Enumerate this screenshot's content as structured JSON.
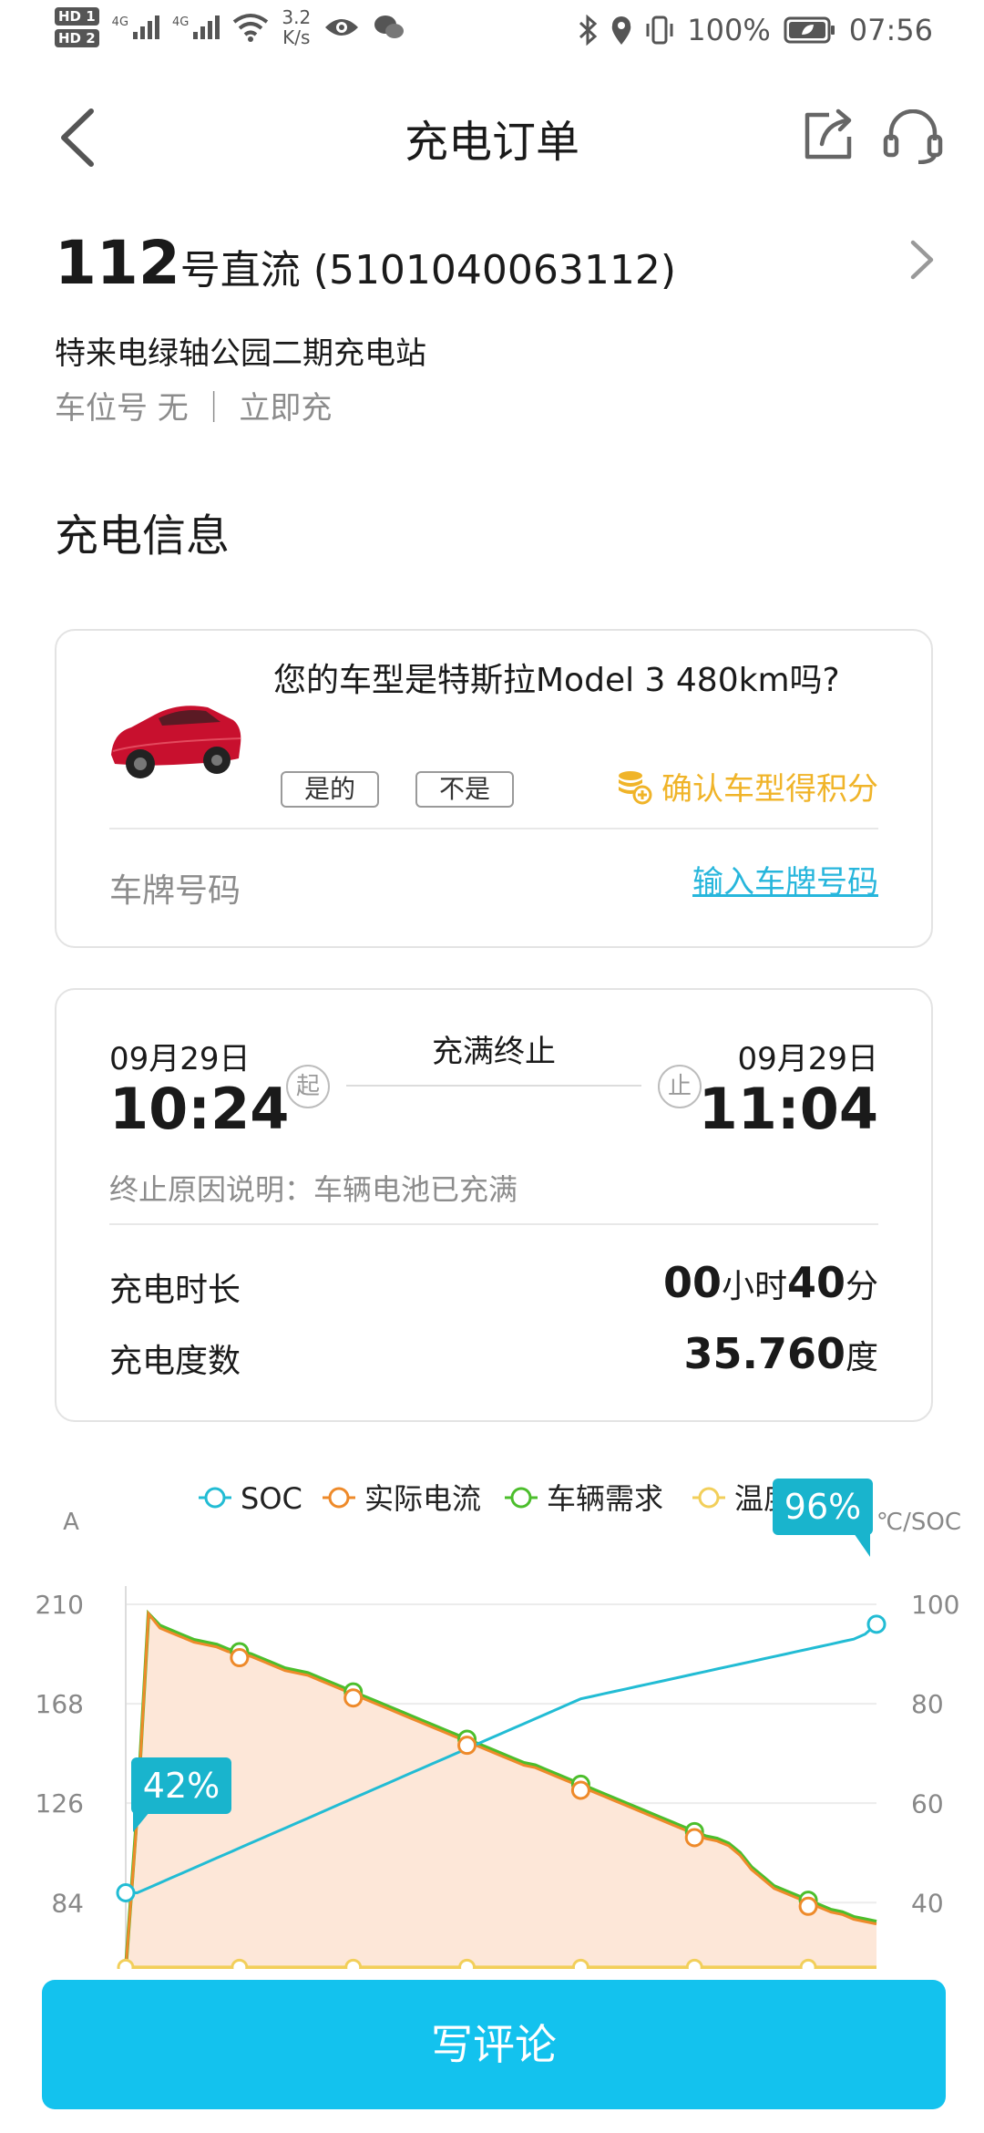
{
  "status_bar": {
    "hd1": "HD 1",
    "hd2": "HD 2",
    "net1": "4G",
    "net2": "4G",
    "speed_value": "3.2",
    "speed_unit": "K/s",
    "battery": "100%",
    "time": "07:56"
  },
  "nav": {
    "title": "充电订单",
    "icons": [
      "back-arrow-icon",
      "share-icon",
      "headset-icon"
    ]
  },
  "station": {
    "number": "112",
    "type": "号直流",
    "code": "(5101040063112)",
    "name": "特来电绿轴公园二期充电站",
    "meta": "车位号 无 ｜ 立即充"
  },
  "section_title": "充电信息",
  "car_card": {
    "question": "您的车型是特斯拉Model 3 480km吗?",
    "yes_label": "是的",
    "no_label": "不是",
    "points_label": "确认车型得积分",
    "plate_label": "车牌号码",
    "plate_link": "输入车牌号码",
    "car_color": "#c8102e"
  },
  "time_card": {
    "start_date": "09月29日",
    "start_time": "10:24",
    "end_date": "09月29日",
    "end_time": "11:04",
    "status": "充满终止",
    "start_marker": "起",
    "end_marker": "止",
    "reason": "终止原因说明：车辆电池已充满",
    "duration_label": "充电时长",
    "duration_hours": "00",
    "duration_hours_unit": "小时",
    "duration_minutes": "40",
    "duration_minutes_unit": "分",
    "energy_label": "充电度数",
    "energy_value": "35.760",
    "energy_unit": "度"
  },
  "chart_data": {
    "type": "line",
    "legend": [
      "SOC",
      "实际电流",
      "车辆需求",
      "温度"
    ],
    "left_axis_label": "A",
    "right_axis_label": "℃/SOC",
    "left_ticks": [
      210,
      168,
      126,
      84
    ],
    "right_ticks": [
      100,
      80,
      60,
      40
    ],
    "left_ylim": [
      56,
      210
    ],
    "right_ylim": [
      26.7,
      100
    ],
    "x": [
      0,
      1,
      2,
      3,
      4,
      5,
      6,
      7,
      8,
      9,
      10,
      11,
      12,
      13,
      14,
      15,
      16,
      17,
      18,
      19,
      20,
      21,
      22,
      23,
      24,
      25,
      26,
      27,
      28,
      29,
      30,
      31,
      32,
      33,
      34,
      35,
      36,
      37,
      38,
      39,
      40,
      41,
      42,
      43,
      44,
      45,
      46,
      47,
      48,
      49,
      50,
      51,
      52,
      53,
      54,
      55,
      56,
      57,
      58,
      59,
      60,
      61,
      62,
      63,
      64,
      65,
      66
    ],
    "series": [
      {
        "name": "SOC",
        "color": "#22bcd4",
        "values": [
          42,
          42,
          43,
          44,
          45,
          46,
          47,
          48,
          49,
          50,
          51,
          52,
          53,
          54,
          55,
          56,
          57,
          58,
          59,
          60,
          61,
          62,
          63,
          64,
          65,
          66,
          67,
          68,
          69,
          70,
          71,
          72,
          73,
          74,
          75,
          76,
          77,
          78,
          79,
          80,
          81,
          81.5,
          82,
          82.5,
          83,
          83.5,
          84,
          84.5,
          85,
          85.5,
          86,
          86.5,
          87,
          87.5,
          88,
          88.5,
          89,
          89.5,
          90,
          90.5,
          91,
          91.5,
          92,
          92.5,
          93,
          94,
          96
        ]
      },
      {
        "name": "实际电流",
        "color": "#ee8a2a",
        "values": [
          56,
          120,
          206,
          200,
          198,
          196,
          194,
          193,
          192,
          190,
          189,
          188,
          186,
          184,
          182,
          181,
          180,
          178,
          176,
          174,
          172,
          170,
          168,
          166,
          164,
          162,
          160,
          158,
          156,
          154,
          152,
          150,
          148,
          146,
          144,
          142,
          141,
          139,
          137,
          135,
          133,
          131,
          129,
          127,
          125,
          123,
          121,
          119,
          117,
          115,
          113,
          111,
          110,
          108,
          104,
          98,
          94,
          90,
          88,
          86,
          84,
          82,
          80,
          79,
          77,
          76,
          75
        ]
      },
      {
        "name": "车辆需求",
        "color": "#4cbe2c",
        "values": [
          56,
          122,
          206,
          201,
          199,
          197,
          195,
          194,
          193,
          191,
          190,
          189,
          187,
          185,
          183,
          182,
          181,
          179,
          177,
          175,
          173,
          171,
          169,
          167,
          165,
          163,
          161,
          159,
          157,
          155,
          153,
          151,
          149,
          147,
          145,
          143,
          142,
          140,
          138,
          136,
          134,
          132,
          130,
          128,
          126,
          124,
          122,
          120,
          118,
          116,
          114,
          112,
          111,
          109,
          105,
          99,
          95,
          91,
          89,
          87,
          85,
          83,
          81,
          80,
          78,
          77,
          76
        ]
      },
      {
        "name": "温度",
        "color": "#f2cf5a",
        "values": [
          27,
          27,
          27,
          27,
          27,
          27,
          27,
          27,
          27,
          27,
          27,
          27,
          27,
          27,
          27,
          27,
          27,
          27,
          27,
          27,
          27,
          27,
          27,
          27,
          27,
          27,
          27,
          27,
          27,
          27,
          27,
          27,
          27,
          27,
          27,
          27,
          27,
          27,
          27,
          27,
          27,
          27,
          27,
          27,
          27,
          27,
          27,
          27,
          27,
          27,
          27,
          27,
          27,
          27,
          27,
          27,
          27,
          27,
          27,
          27,
          27,
          27,
          27,
          27,
          27,
          27,
          27
        ]
      }
    ],
    "start_label": "42%",
    "end_label": "96%",
    "fill_color": "#fde7d8"
  },
  "review_button_label": "写评论"
}
